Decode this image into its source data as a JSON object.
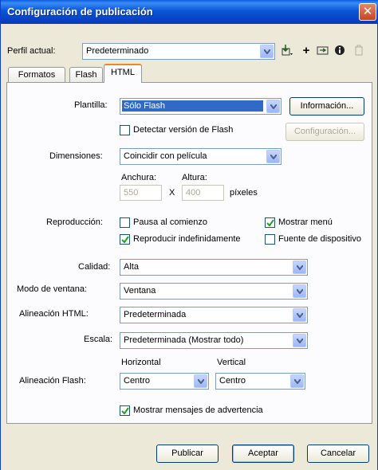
{
  "window": {
    "title": "Configuración de publicación",
    "close_glyph": "✕"
  },
  "profile": {
    "label": "Perfil actual:",
    "value": "Predeterminado",
    "icons": [
      "import-export-icon",
      "add-profile-icon",
      "duplicate-profile-icon",
      "info-icon",
      "delete-icon"
    ]
  },
  "tabs": [
    {
      "label": "Formatos"
    },
    {
      "label": "Flash"
    },
    {
      "label": "HTML"
    }
  ],
  "html_tab": {
    "template": {
      "label": "Plantilla:",
      "value": "Sólo Flash",
      "info_button": "Información..."
    },
    "detect_flash": {
      "label": "Detectar versión de Flash",
      "checked": false,
      "config_button": "Configuración..."
    },
    "dimensions": {
      "label": "Dimensiones:",
      "value": "Coincidir con película",
      "width_label": "Anchura:",
      "height_label": "Altura:",
      "width_value": "550",
      "height_value": "400",
      "x_sep": "X",
      "unit": "píxeles"
    },
    "playback": {
      "label": "Reproducción:",
      "pause": {
        "label": "Pausa al comienzo",
        "checked": false
      },
      "show_menu": {
        "label": "Mostrar menú",
        "checked": true
      },
      "loop": {
        "label": "Reproducir indefinidamente",
        "checked": true
      },
      "device_font": {
        "label": "Fuente de dispositivo",
        "checked": false
      }
    },
    "quality": {
      "label": "Calidad:",
      "value": "Alta"
    },
    "window_mode": {
      "label": "Modo de ventana:",
      "value": "Ventana"
    },
    "html_align": {
      "label": "Alineación HTML:",
      "value": "Predeterminada"
    },
    "scale": {
      "label": "Escala:",
      "value": "Predeterminada (Mostrar todo)"
    },
    "flash_align": {
      "label": "Alineación Flash:",
      "horizontal_label": "Horizontal",
      "vertical_label": "Vertical",
      "horizontal_value": "Centro",
      "vertical_value": "Centro"
    },
    "warnings": {
      "label": "Mostrar mensajes de advertencia",
      "checked": true
    }
  },
  "footer": {
    "publish": "Publicar",
    "accept": "Aceptar",
    "cancel": "Cancelar"
  },
  "colors": {
    "titlebar": "#0a55d8",
    "accent_tab": "#e68b2c",
    "selection": "#316ac5"
  }
}
